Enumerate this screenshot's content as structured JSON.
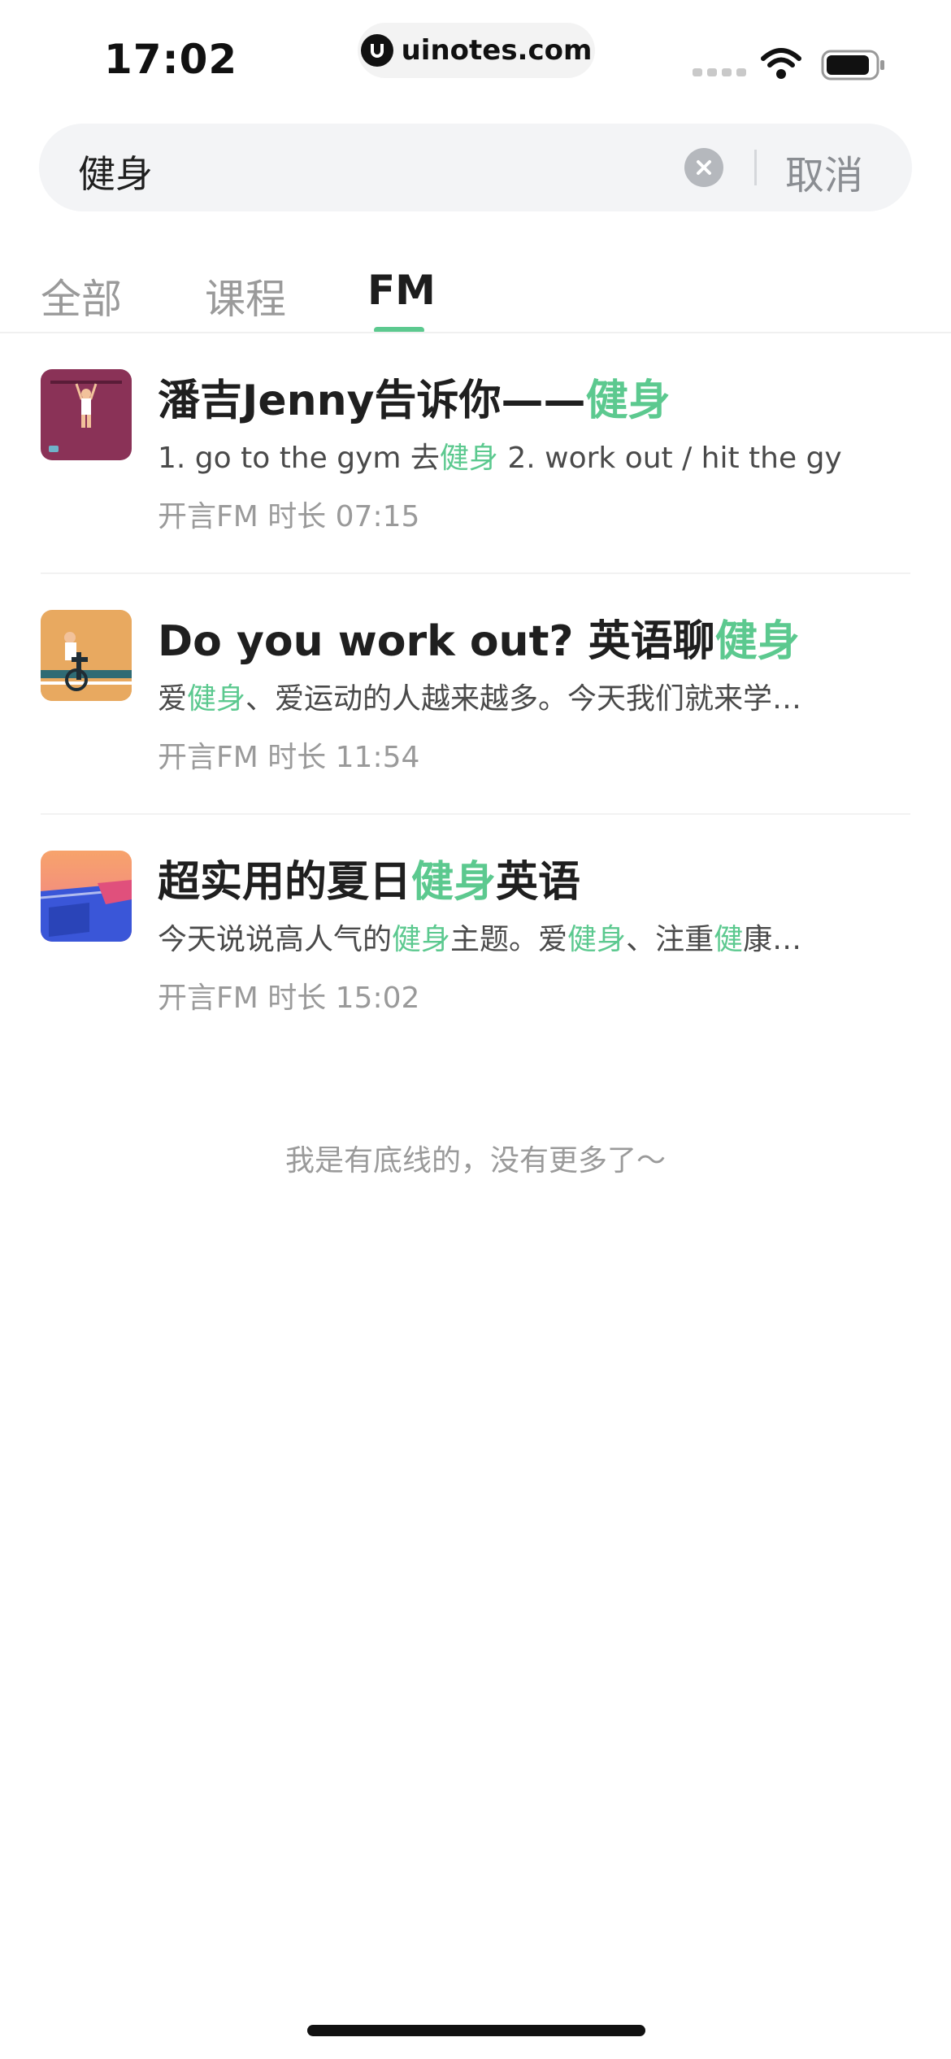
{
  "status_bar": {
    "time": "17:02",
    "url": "uinotes.com"
  },
  "search": {
    "query": "健身",
    "cancel_label": "取消"
  },
  "tabs": [
    {
      "label": "全部",
      "active": false
    },
    {
      "label": "课程",
      "active": false
    },
    {
      "label": "FM",
      "active": true
    }
  ],
  "results": [
    {
      "title_parts": [
        "潘吉Jenny告诉你——",
        "健身"
      ],
      "desc_parts": [
        "1. go to the gym 去",
        "健身",
        " 2. work out / hit the gy"
      ],
      "meta": "开言FM 时长 07:15"
    },
    {
      "title_parts": [
        "Do you work out? 英语聊",
        "健身"
      ],
      "desc_parts": [
        "爱",
        "健身",
        "、爱运动的人越来越多。今天我们就来学…"
      ],
      "meta": "开言FM 时长 11:54"
    },
    {
      "title_parts": [
        "超实用的夏日",
        "健身",
        "英语"
      ],
      "desc_parts": [
        "今天说说高人气的",
        "健身",
        "主题。爱",
        "健身",
        "、注重",
        "健",
        "康…"
      ],
      "meta": "开言FM 时长 15:02"
    }
  ],
  "end_text": "我是有底线的，没有更多了～",
  "colors": {
    "accent": "#5cc98f",
    "search_bg": "#f3f4f6"
  }
}
